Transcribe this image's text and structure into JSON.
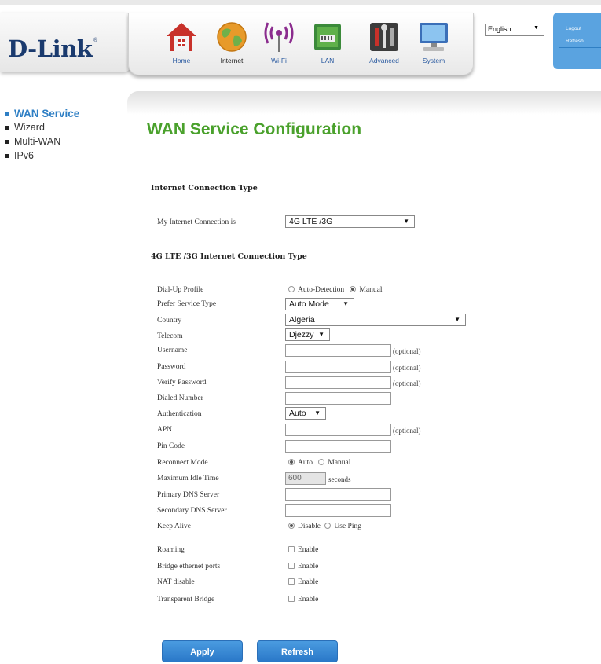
{
  "header": {
    "logo": "D-Link",
    "logo_mark": "®",
    "nav": [
      {
        "label": "Home",
        "icon": "home-icon"
      },
      {
        "label": "Internet",
        "icon": "globe-icon"
      },
      {
        "label": "Wi-Fi",
        "icon": "wifi-icon"
      },
      {
        "label": "LAN",
        "icon": "lan-port-icon"
      },
      {
        "label": "Advanced",
        "icon": "tools-icon"
      },
      {
        "label": "System",
        "icon": "computer-icon"
      }
    ],
    "language": "English",
    "logout": "Logout",
    "refresh": "Refresh"
  },
  "sidebar": {
    "items": [
      {
        "label": "WAN Service",
        "active": true
      },
      {
        "label": "Wizard"
      },
      {
        "label": "Multi-WAN"
      },
      {
        "label": "IPv6"
      }
    ]
  },
  "main": {
    "title": "WAN Service Configuration",
    "section1": "Internet Connection Type",
    "conn_label": "My Internet Connection is",
    "conn_value": "4G LTE /3G",
    "section2": "4G LTE /3G Internet Connection Type",
    "fields": {
      "dialup_label": "Dial-Up Profile",
      "dialup_opt1": "Auto-Detection",
      "dialup_opt2": "Manual",
      "service_label": "Prefer Service Type",
      "service_value": "Auto Mode",
      "country_label": "Country",
      "country_value": "Algeria",
      "telecom_label": "Telecom",
      "telecom_value": "Djezzy",
      "username_label": "Username",
      "password_label": "Password",
      "verify_label": "Verify Password",
      "dialed_label": "Dialed Number",
      "auth_label": "Authentication",
      "auth_value": "Auto",
      "apn_label": "APN",
      "pin_label": "Pin Code",
      "reconnect_label": "Reconnect Mode",
      "reconnect_opt1": "Auto",
      "reconnect_opt2": "Manual",
      "idle_label": "Maximum Idle Time",
      "idle_value": "600",
      "idle_unit": "seconds",
      "dns1_label": "Primary DNS Server",
      "dns2_label": "Secondary DNS Server",
      "keepalive_label": "Keep Alive",
      "keepalive_opt1": "Disable",
      "keepalive_opt2": "Use Ping",
      "roaming_label": "Roaming",
      "bridge_label": "Bridge ethernet ports",
      "nat_label": "NAT disable",
      "transparent_label": "Transparent Bridge",
      "enable": "Enable",
      "optional": "(optional)"
    },
    "apply": "Apply",
    "refresh": "Refresh"
  }
}
